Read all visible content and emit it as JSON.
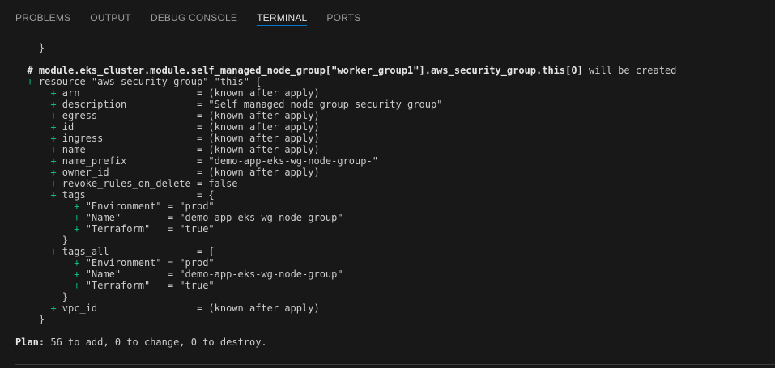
{
  "panel": {
    "tabs": [
      {
        "label": "PROBLEMS",
        "active": false
      },
      {
        "label": "OUTPUT",
        "active": false
      },
      {
        "label": "DEBUG CONSOLE",
        "active": false
      },
      {
        "label": "TERMINAL",
        "active": true
      },
      {
        "label": "PORTS",
        "active": false
      }
    ],
    "colors": {
      "background": "#181818",
      "active_tab_underline": "#0078d4",
      "plus_sign": "#0dbc79",
      "text": "#cccccc"
    }
  },
  "terminal": {
    "lines": [
      {
        "text": "    }"
      },
      {
        "text": ""
      },
      {
        "text": "  # module.eks_cluster.module.self_managed_node_group[\"worker_group1\"].aws_security_group.this[0]",
        "rest": " will be created",
        "bold": true
      },
      {
        "plus": "  + ",
        "text": "resource \"aws_security_group\" \"this\" {"
      },
      {
        "plus": "      + ",
        "text": "arn                    = (known after apply)"
      },
      {
        "plus": "      + ",
        "text": "description            = \"Self managed node group security group\""
      },
      {
        "plus": "      + ",
        "text": "egress                 = (known after apply)"
      },
      {
        "plus": "      + ",
        "text": "id                     = (known after apply)"
      },
      {
        "plus": "      + ",
        "text": "ingress                = (known after apply)"
      },
      {
        "plus": "      + ",
        "text": "name                   = (known after apply)"
      },
      {
        "plus": "      + ",
        "text": "name_prefix            = \"demo-app-eks-wg-node-group-\""
      },
      {
        "plus": "      + ",
        "text": "owner_id               = (known after apply)"
      },
      {
        "plus": "      + ",
        "text": "revoke_rules_on_delete = false"
      },
      {
        "plus": "      + ",
        "text": "tags                   = {"
      },
      {
        "plus": "          + ",
        "text": "\"Environment\" = \"prod\""
      },
      {
        "plus": "          + ",
        "text": "\"Name\"        = \"demo-app-eks-wg-node-group\""
      },
      {
        "plus": "          + ",
        "text": "\"Terraform\"   = \"true\""
      },
      {
        "text": "        }"
      },
      {
        "plus": "      + ",
        "text": "tags_all               = {"
      },
      {
        "plus": "          + ",
        "text": "\"Environment\" = \"prod\""
      },
      {
        "plus": "          + ",
        "text": "\"Name\"        = \"demo-app-eks-wg-node-group\""
      },
      {
        "plus": "          + ",
        "text": "\"Terraform\"   = \"true\""
      },
      {
        "text": "        }"
      },
      {
        "plus": "      + ",
        "text": "vpc_id                 = (known after apply)"
      },
      {
        "text": "    }"
      },
      {
        "text": ""
      },
      {
        "label": "Plan:",
        "text": " 56 to add, 0 to change, 0 to destroy."
      }
    ]
  }
}
